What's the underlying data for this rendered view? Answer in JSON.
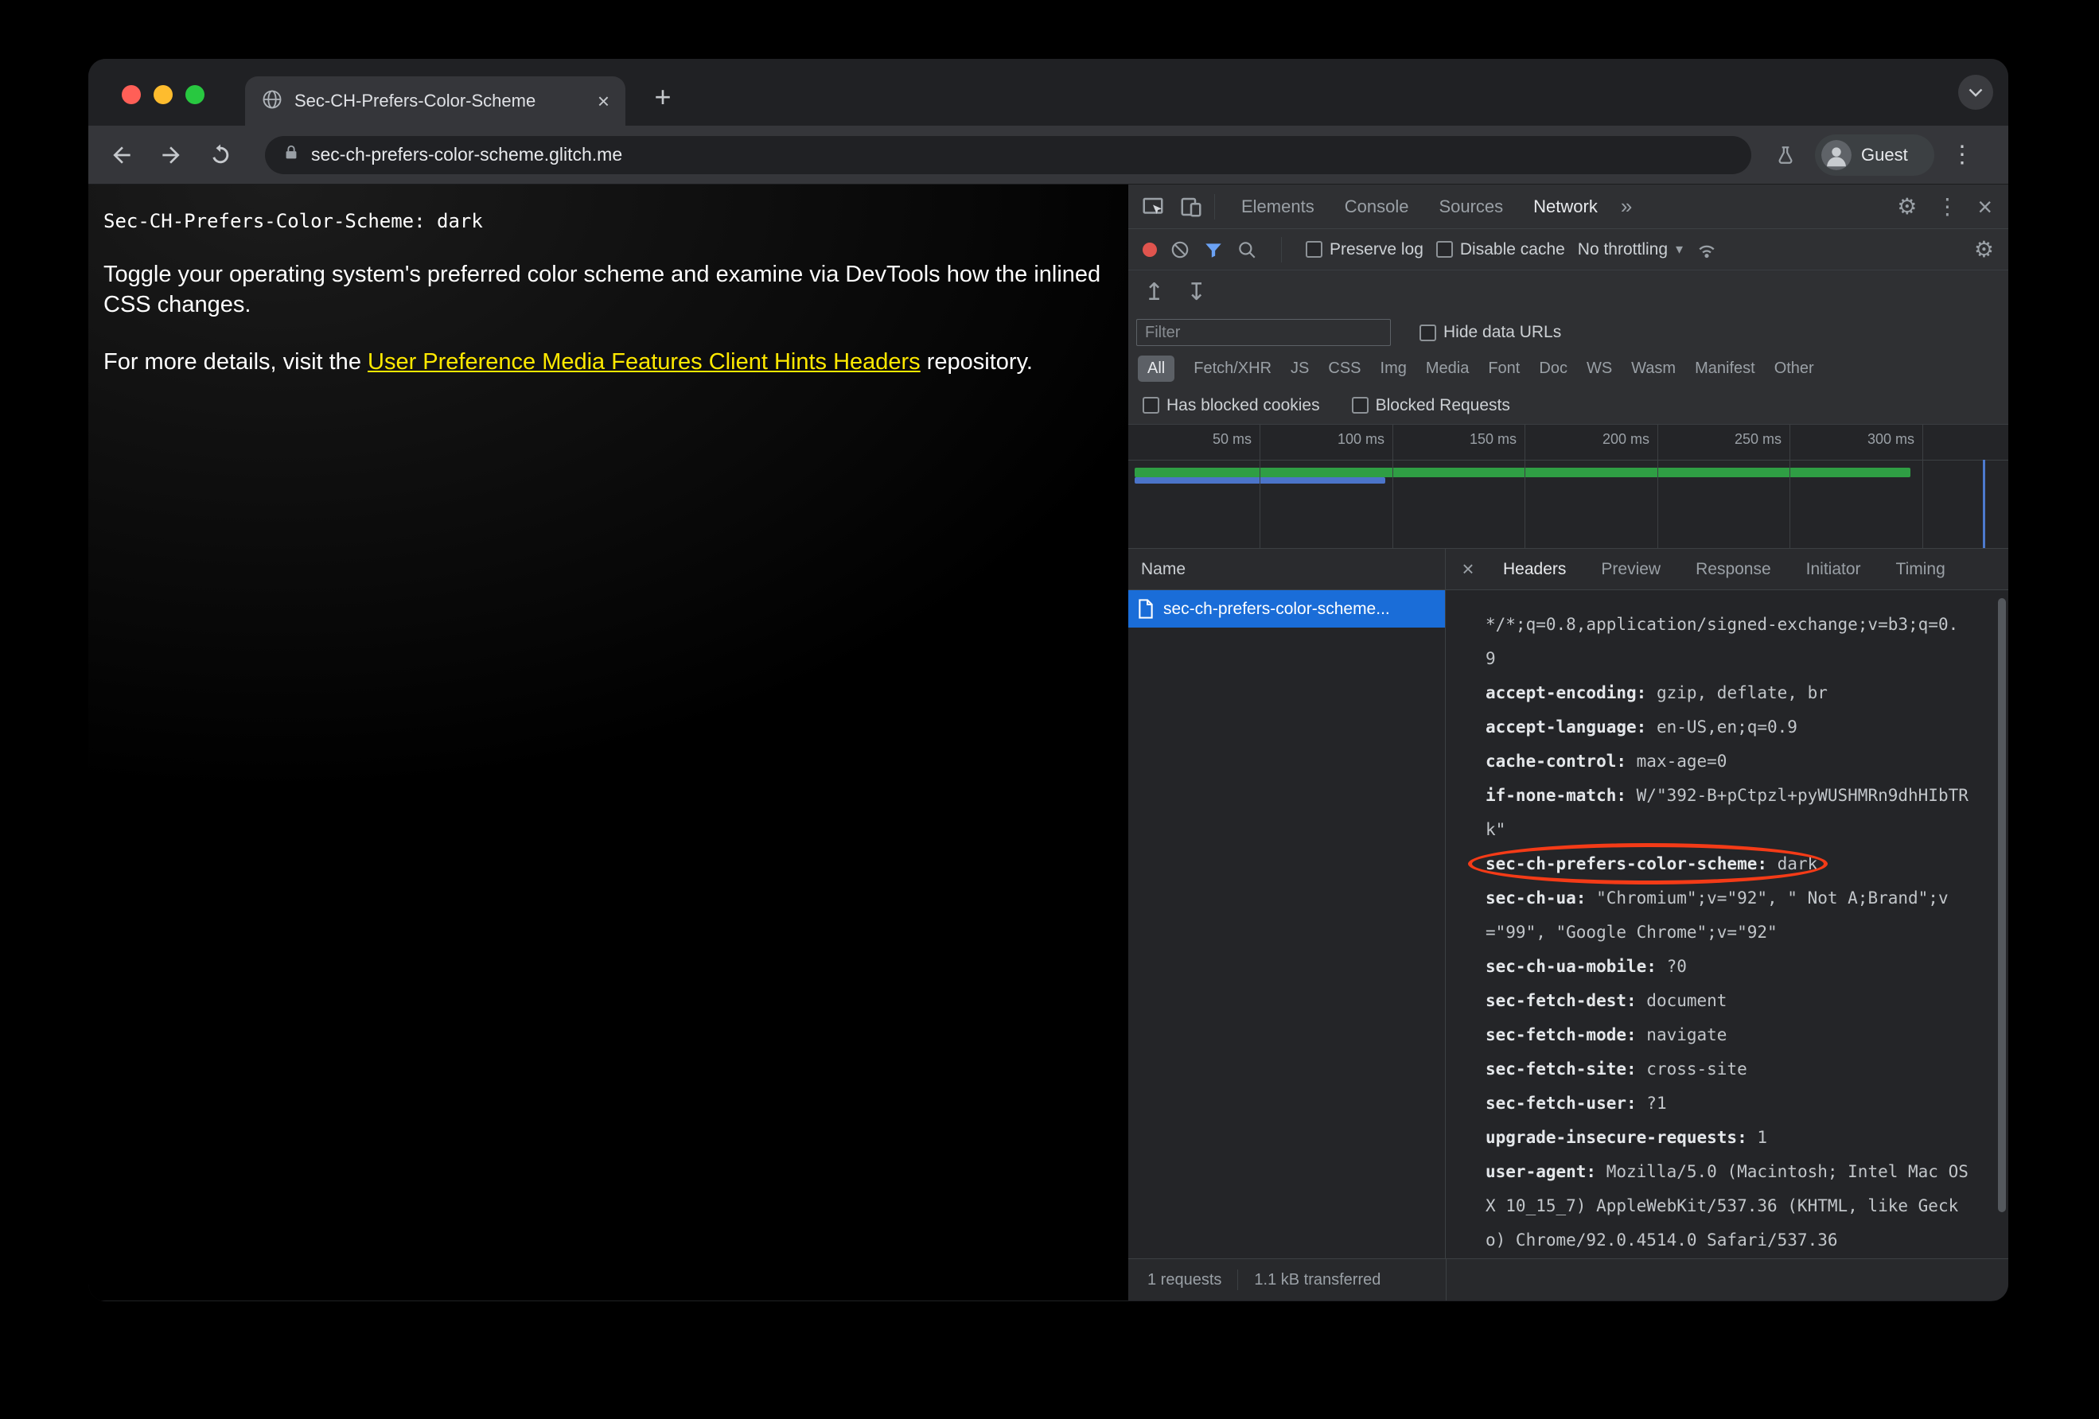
{
  "icons": {
    "close_tab": "×",
    "new_tab": "+",
    "tab_chevron": "∨",
    "menu_kebab": "⋮",
    "devtools_kebab": "⋮",
    "more_tabs": "»",
    "caret_down": "▾",
    "gear": "⚙",
    "import_har": "↥",
    "export_har": "↧",
    "close_devtools": "×",
    "close_detail": "×"
  },
  "browser": {
    "tab_title": "Sec-CH-Prefers-Color-Scheme",
    "url": "sec-ch-prefers-color-scheme.glitch.me",
    "profile_label": "Guest"
  },
  "page": {
    "mono_heading": "Sec-CH-Prefers-Color-Scheme: dark",
    "para1": "Toggle your operating system's preferred color scheme and examine via DevTools how the inlined CSS changes.",
    "para2_prefix": "For more details, visit the ",
    "para2_link_text": "User Preference Media Features Client Hints Headers",
    "para2_suffix": " repository."
  },
  "devtools": {
    "panel_tabs": [
      {
        "label": "Elements",
        "selected": false
      },
      {
        "label": "Console",
        "selected": false
      },
      {
        "label": "Sources",
        "selected": false
      },
      {
        "label": "Network",
        "selected": true
      }
    ],
    "controls": {
      "preserve_log": "Preserve log",
      "disable_cache": "Disable cache",
      "throttling": "No throttling"
    },
    "filter_bar": {
      "filter_placeholder": "Filter",
      "hide_data_urls": "Hide data URLs"
    },
    "type_pills": [
      {
        "label": "All",
        "selected": true
      },
      {
        "label": "Fetch/XHR"
      },
      {
        "label": "JS"
      },
      {
        "label": "CSS"
      },
      {
        "label": "Img"
      },
      {
        "label": "Media"
      },
      {
        "label": "Font"
      },
      {
        "label": "Doc"
      },
      {
        "label": "WS"
      },
      {
        "label": "Wasm"
      },
      {
        "label": "Manifest"
      },
      {
        "label": "Other"
      }
    ],
    "blocked_bar": {
      "has_blocked_cookies": "Has blocked cookies",
      "blocked_requests": "Blocked Requests"
    },
    "timeline_ticks": [
      "50 ms",
      "100 ms",
      "150 ms",
      "200 ms",
      "250 ms",
      "300 ms"
    ],
    "requests_table": {
      "name_header": "Name",
      "rows": [
        {
          "label": "sec-ch-prefers-color-scheme...",
          "selected": true
        }
      ]
    },
    "detail_tabs": [
      {
        "label": "Headers",
        "selected": true
      },
      {
        "label": "Preview",
        "selected": false
      },
      {
        "label": "Response",
        "selected": false
      },
      {
        "label": "Initiator",
        "selected": false
      },
      {
        "label": "Timing",
        "selected": false
      }
    ],
    "request_headers": [
      {
        "segments": [
          {
            "text": "*/*;q=0.8,application/signed-exchange;v=b3;q=0.",
            "bold": false
          }
        ]
      },
      {
        "segments": [
          {
            "text": "9",
            "bold": false
          }
        ]
      },
      {
        "segments": [
          {
            "text": "accept-encoding:",
            "bold": true
          },
          {
            "text": " gzip, deflate, br",
            "bold": false
          }
        ]
      },
      {
        "segments": [
          {
            "text": "accept-language:",
            "bold": true
          },
          {
            "text": " en-US,en;q=0.9",
            "bold": false
          }
        ]
      },
      {
        "segments": [
          {
            "text": "cache-control:",
            "bold": true
          },
          {
            "text": " max-age=0",
            "bold": false
          }
        ]
      },
      {
        "segments": [
          {
            "text": "if-none-match:",
            "bold": true
          },
          {
            "text": " W/\"392-B+pCtpzl+pyWUSHMRn9dhHIbTR",
            "bold": false
          }
        ]
      },
      {
        "segments": [
          {
            "text": "k\"",
            "bold": false
          }
        ]
      },
      {
        "segments": [
          {
            "text": "sec-ch-prefers-color-scheme:",
            "bold": true
          },
          {
            "text": " dark",
            "bold": false
          }
        ],
        "circled": true
      },
      {
        "segments": [
          {
            "text": "sec-ch-ua:",
            "bold": true
          },
          {
            "text": " \"Chromium\";v=\"92\", \" Not A;Brand\";v",
            "bold": false
          }
        ]
      },
      {
        "segments": [
          {
            "text": "=\"99\", \"Google Chrome\";v=\"92\"",
            "bold": false
          }
        ]
      },
      {
        "segments": [
          {
            "text": "sec-ch-ua-mobile:",
            "bold": true
          },
          {
            "text": " ?0",
            "bold": false
          }
        ]
      },
      {
        "segments": [
          {
            "text": "sec-fetch-dest:",
            "bold": true
          },
          {
            "text": " document",
            "bold": false
          }
        ]
      },
      {
        "segments": [
          {
            "text": "sec-fetch-mode:",
            "bold": true
          },
          {
            "text": " navigate",
            "bold": false
          }
        ]
      },
      {
        "segments": [
          {
            "text": "sec-fetch-site:",
            "bold": true
          },
          {
            "text": " cross-site",
            "bold": false
          }
        ]
      },
      {
        "segments": [
          {
            "text": "sec-fetch-user:",
            "bold": true
          },
          {
            "text": " ?1",
            "bold": false
          }
        ]
      },
      {
        "segments": [
          {
            "text": "upgrade-insecure-requests:",
            "bold": true
          },
          {
            "text": " 1",
            "bold": false
          }
        ]
      },
      {
        "segments": [
          {
            "text": "user-agent:",
            "bold": true
          },
          {
            "text": " Mozilla/5.0 (Macintosh; Intel Mac OS",
            "bold": false
          }
        ]
      },
      {
        "segments": [
          {
            "text": "X 10_15_7) AppleWebKit/537.36 (KHTML, like Geck",
            "bold": false
          }
        ]
      },
      {
        "segments": [
          {
            "text": "o) Chrome/92.0.4514.0 Safari/537.36",
            "bold": false
          }
        ]
      }
    ],
    "status_bar": {
      "requests_count": "1 requests",
      "transferred": "1.1 kB transferred"
    }
  },
  "colors": {
    "selected_row": "#1a6dd8",
    "annotation": "#f43b17",
    "record_dot": "#e0544e",
    "overview_green": "#2f9e44",
    "overview_blue": "#4b74c9",
    "link": "#ffe900",
    "funnel_active": "#6ba2f5",
    "traffic_red": "#ff5f57",
    "traffic_yellow": "#febc2e",
    "traffic_green": "#28c840"
  }
}
